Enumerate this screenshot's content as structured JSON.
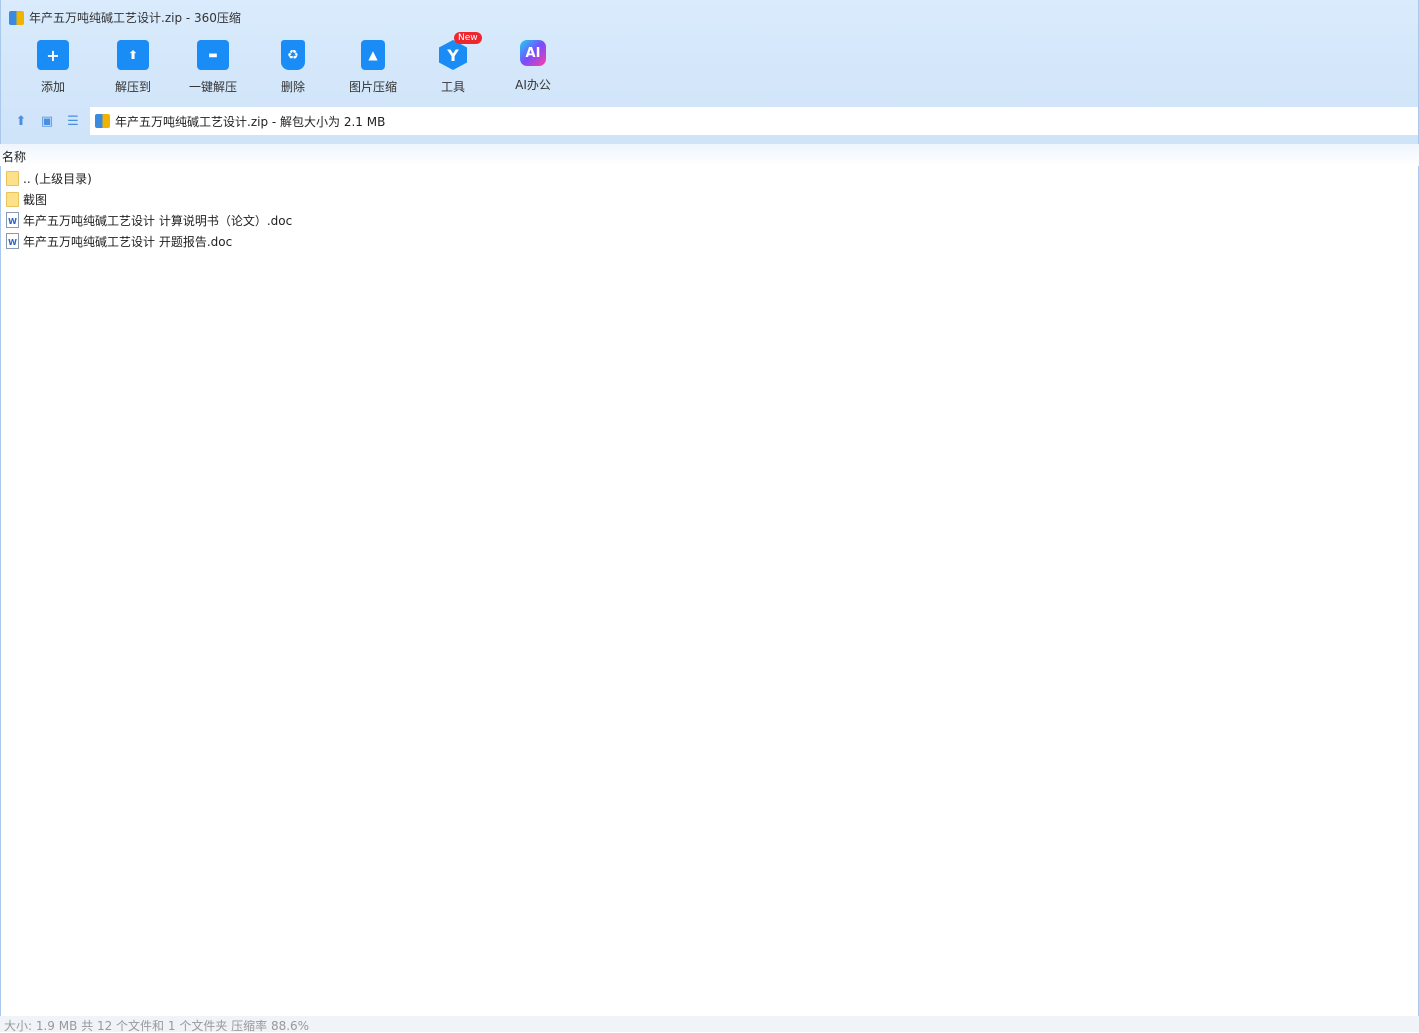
{
  "window": {
    "title": "年产五万吨纯碱工艺设计.zip - 360压缩"
  },
  "toolbar": [
    {
      "label": "添加",
      "icon": "add-folder-icon",
      "glyph": "+"
    },
    {
      "label": "解压到",
      "icon": "extract-to-icon",
      "glyph": "⬆"
    },
    {
      "label": "一键解压",
      "icon": "one-click-extract-icon",
      "glyph": "▬"
    },
    {
      "label": "删除",
      "icon": "recycle-bin-icon",
      "glyph": "♻"
    },
    {
      "label": "图片压缩",
      "icon": "image-compress-icon",
      "glyph": "▲"
    },
    {
      "label": "工具",
      "icon": "tools-icon",
      "glyph": "Y",
      "badge": "New"
    },
    {
      "label": "AI办公",
      "icon": "ai-office-icon",
      "glyph": "AI"
    }
  ],
  "address": {
    "text": "年产五万吨纯碱工艺设计.zip - 解包大小为 2.1 MB"
  },
  "list": {
    "header": "名称",
    "items": [
      {
        "name": ".. (上级目录)",
        "type": "folder"
      },
      {
        "name": "截图",
        "type": "folder"
      },
      {
        "name": "年产五万吨纯碱工艺设计 计算说明书（论文）.doc",
        "type": "doc"
      },
      {
        "name": "年产五万吨纯碱工艺设计 开题报告.doc",
        "type": "doc"
      }
    ]
  },
  "status": "大小: 1.9 MB 共 12 个文件和 1 个文件夹 压缩率 88.6%"
}
